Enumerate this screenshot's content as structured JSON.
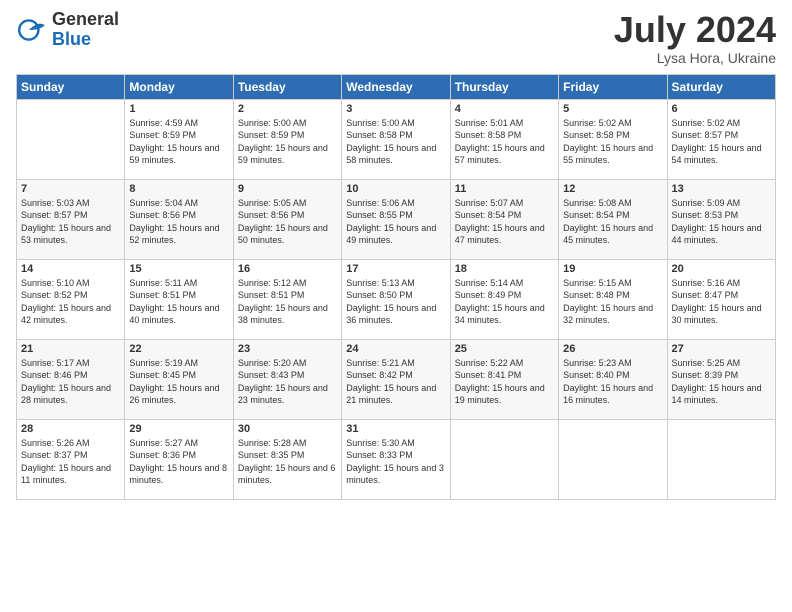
{
  "header": {
    "logo_general": "General",
    "logo_blue": "Blue",
    "month": "July 2024",
    "location": "Lysa Hora, Ukraine"
  },
  "days_of_week": [
    "Sunday",
    "Monday",
    "Tuesday",
    "Wednesday",
    "Thursday",
    "Friday",
    "Saturday"
  ],
  "weeks": [
    [
      {
        "day": "",
        "sunrise": "",
        "sunset": "",
        "daylight": ""
      },
      {
        "day": "1",
        "sunrise": "Sunrise: 4:59 AM",
        "sunset": "Sunset: 8:59 PM",
        "daylight": "Daylight: 15 hours and 59 minutes."
      },
      {
        "day": "2",
        "sunrise": "Sunrise: 5:00 AM",
        "sunset": "Sunset: 8:59 PM",
        "daylight": "Daylight: 15 hours and 59 minutes."
      },
      {
        "day": "3",
        "sunrise": "Sunrise: 5:00 AM",
        "sunset": "Sunset: 8:58 PM",
        "daylight": "Daylight: 15 hours and 58 minutes."
      },
      {
        "day": "4",
        "sunrise": "Sunrise: 5:01 AM",
        "sunset": "Sunset: 8:58 PM",
        "daylight": "Daylight: 15 hours and 57 minutes."
      },
      {
        "day": "5",
        "sunrise": "Sunrise: 5:02 AM",
        "sunset": "Sunset: 8:58 PM",
        "daylight": "Daylight: 15 hours and 55 minutes."
      },
      {
        "day": "6",
        "sunrise": "Sunrise: 5:02 AM",
        "sunset": "Sunset: 8:57 PM",
        "daylight": "Daylight: 15 hours and 54 minutes."
      }
    ],
    [
      {
        "day": "7",
        "sunrise": "Sunrise: 5:03 AM",
        "sunset": "Sunset: 8:57 PM",
        "daylight": "Daylight: 15 hours and 53 minutes."
      },
      {
        "day": "8",
        "sunrise": "Sunrise: 5:04 AM",
        "sunset": "Sunset: 8:56 PM",
        "daylight": "Daylight: 15 hours and 52 minutes."
      },
      {
        "day": "9",
        "sunrise": "Sunrise: 5:05 AM",
        "sunset": "Sunset: 8:56 PM",
        "daylight": "Daylight: 15 hours and 50 minutes."
      },
      {
        "day": "10",
        "sunrise": "Sunrise: 5:06 AM",
        "sunset": "Sunset: 8:55 PM",
        "daylight": "Daylight: 15 hours and 49 minutes."
      },
      {
        "day": "11",
        "sunrise": "Sunrise: 5:07 AM",
        "sunset": "Sunset: 8:54 PM",
        "daylight": "Daylight: 15 hours and 47 minutes."
      },
      {
        "day": "12",
        "sunrise": "Sunrise: 5:08 AM",
        "sunset": "Sunset: 8:54 PM",
        "daylight": "Daylight: 15 hours and 45 minutes."
      },
      {
        "day": "13",
        "sunrise": "Sunrise: 5:09 AM",
        "sunset": "Sunset: 8:53 PM",
        "daylight": "Daylight: 15 hours and 44 minutes."
      }
    ],
    [
      {
        "day": "14",
        "sunrise": "Sunrise: 5:10 AM",
        "sunset": "Sunset: 8:52 PM",
        "daylight": "Daylight: 15 hours and 42 minutes."
      },
      {
        "day": "15",
        "sunrise": "Sunrise: 5:11 AM",
        "sunset": "Sunset: 8:51 PM",
        "daylight": "Daylight: 15 hours and 40 minutes."
      },
      {
        "day": "16",
        "sunrise": "Sunrise: 5:12 AM",
        "sunset": "Sunset: 8:51 PM",
        "daylight": "Daylight: 15 hours and 38 minutes."
      },
      {
        "day": "17",
        "sunrise": "Sunrise: 5:13 AM",
        "sunset": "Sunset: 8:50 PM",
        "daylight": "Daylight: 15 hours and 36 minutes."
      },
      {
        "day": "18",
        "sunrise": "Sunrise: 5:14 AM",
        "sunset": "Sunset: 8:49 PM",
        "daylight": "Daylight: 15 hours and 34 minutes."
      },
      {
        "day": "19",
        "sunrise": "Sunrise: 5:15 AM",
        "sunset": "Sunset: 8:48 PM",
        "daylight": "Daylight: 15 hours and 32 minutes."
      },
      {
        "day": "20",
        "sunrise": "Sunrise: 5:16 AM",
        "sunset": "Sunset: 8:47 PM",
        "daylight": "Daylight: 15 hours and 30 minutes."
      }
    ],
    [
      {
        "day": "21",
        "sunrise": "Sunrise: 5:17 AM",
        "sunset": "Sunset: 8:46 PM",
        "daylight": "Daylight: 15 hours and 28 minutes."
      },
      {
        "day": "22",
        "sunrise": "Sunrise: 5:19 AM",
        "sunset": "Sunset: 8:45 PM",
        "daylight": "Daylight: 15 hours and 26 minutes."
      },
      {
        "day": "23",
        "sunrise": "Sunrise: 5:20 AM",
        "sunset": "Sunset: 8:43 PM",
        "daylight": "Daylight: 15 hours and 23 minutes."
      },
      {
        "day": "24",
        "sunrise": "Sunrise: 5:21 AM",
        "sunset": "Sunset: 8:42 PM",
        "daylight": "Daylight: 15 hours and 21 minutes."
      },
      {
        "day": "25",
        "sunrise": "Sunrise: 5:22 AM",
        "sunset": "Sunset: 8:41 PM",
        "daylight": "Daylight: 15 hours and 19 minutes."
      },
      {
        "day": "26",
        "sunrise": "Sunrise: 5:23 AM",
        "sunset": "Sunset: 8:40 PM",
        "daylight": "Daylight: 15 hours and 16 minutes."
      },
      {
        "day": "27",
        "sunrise": "Sunrise: 5:25 AM",
        "sunset": "Sunset: 8:39 PM",
        "daylight": "Daylight: 15 hours and 14 minutes."
      }
    ],
    [
      {
        "day": "28",
        "sunrise": "Sunrise: 5:26 AM",
        "sunset": "Sunset: 8:37 PM",
        "daylight": "Daylight: 15 hours and 11 minutes."
      },
      {
        "day": "29",
        "sunrise": "Sunrise: 5:27 AM",
        "sunset": "Sunset: 8:36 PM",
        "daylight": "Daylight: 15 hours and 8 minutes."
      },
      {
        "day": "30",
        "sunrise": "Sunrise: 5:28 AM",
        "sunset": "Sunset: 8:35 PM",
        "daylight": "Daylight: 15 hours and 6 minutes."
      },
      {
        "day": "31",
        "sunrise": "Sunrise: 5:30 AM",
        "sunset": "Sunset: 8:33 PM",
        "daylight": "Daylight: 15 hours and 3 minutes."
      },
      {
        "day": "",
        "sunrise": "",
        "sunset": "",
        "daylight": ""
      },
      {
        "day": "",
        "sunrise": "",
        "sunset": "",
        "daylight": ""
      },
      {
        "day": "",
        "sunrise": "",
        "sunset": "",
        "daylight": ""
      }
    ]
  ]
}
